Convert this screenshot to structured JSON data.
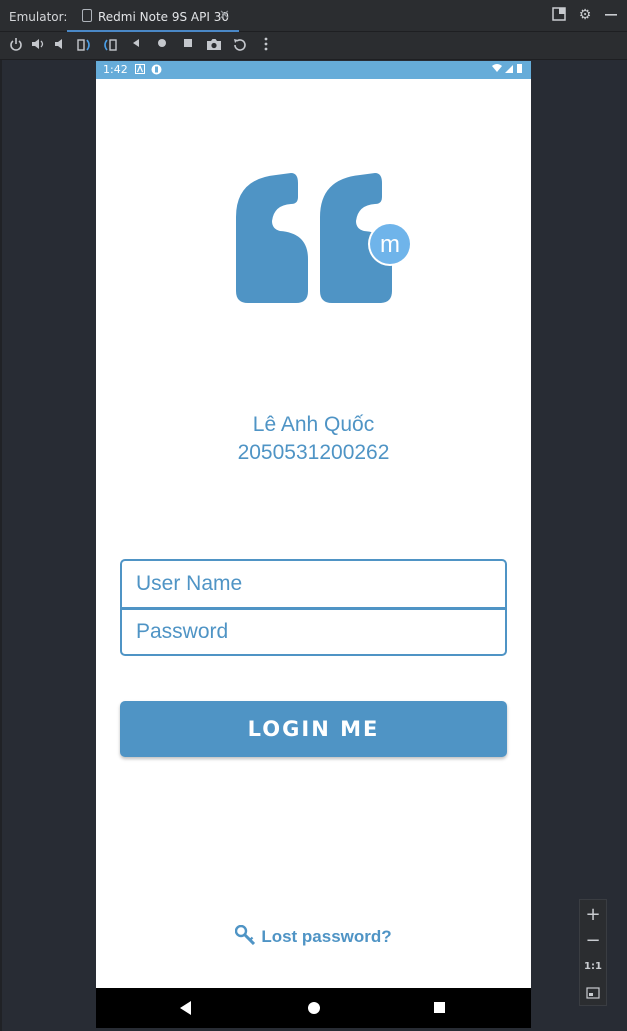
{
  "window": {
    "tool_label": "Emulator:",
    "tab_title": "Redmi Note 9S API 30",
    "close_glyph": "✕"
  },
  "toolbar": {
    "icons": [
      "power-icon",
      "volume-up-icon",
      "volume-down-icon",
      "rotate-left-icon",
      "rotate-right-icon",
      "back-icon",
      "home-icon",
      "overview-icon",
      "camera-icon",
      "snapshot-icon",
      "more-icon"
    ]
  },
  "phone": {
    "status": {
      "time": "1:42"
    },
    "profile": {
      "name": "Lê Anh Quốc",
      "student_id": "2050531200262"
    },
    "form": {
      "username_placeholder": "User Name",
      "password_placeholder": "Password",
      "login_label": "LOGIN ME"
    },
    "lost_password": "Lost password?",
    "brand_color": "#4f94c5",
    "badge_letter": "m"
  },
  "zoom": {
    "plus": "+",
    "minus": "−",
    "one_to_one": "1:1"
  }
}
